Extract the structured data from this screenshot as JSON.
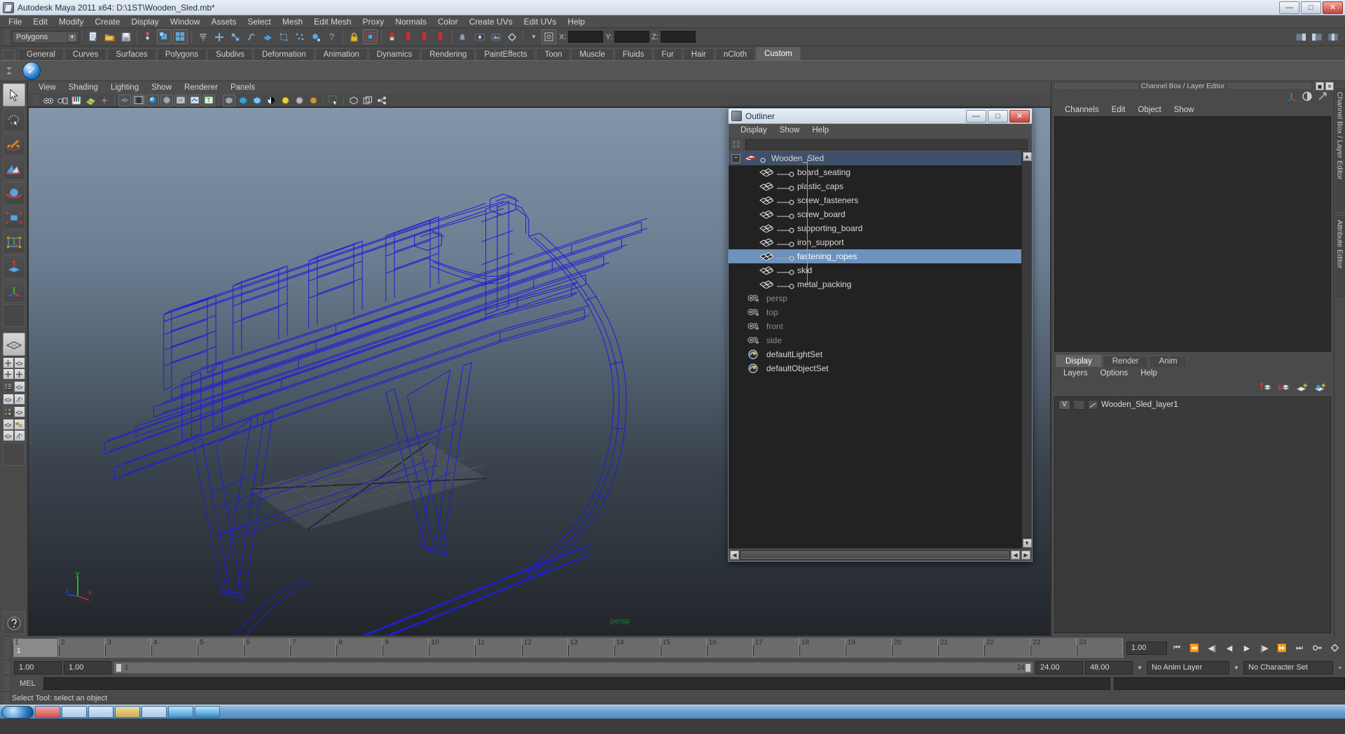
{
  "window": {
    "title": "Autodesk Maya 2011 x64: D:\\1ST\\Wooden_Sled.mb*",
    "icon": "maya-app-icon",
    "buttons": {
      "minimize": "—",
      "maximize": "□",
      "close": "✕"
    }
  },
  "menubar": {
    "items": [
      "File",
      "Edit",
      "Modify",
      "Create",
      "Display",
      "Window",
      "Assets",
      "Select",
      "Mesh",
      "Edit Mesh",
      "Proxy",
      "Normals",
      "Color",
      "Create UVs",
      "Edit UVs",
      "Help"
    ]
  },
  "statusline": {
    "selection_mode": "Polygons",
    "coord_labels": {
      "x": "X:",
      "y": "Y:",
      "z": "Z:"
    },
    "coord_values": {
      "x": "",
      "y": "",
      "z": ""
    }
  },
  "shelf": {
    "tabs": [
      "General",
      "Curves",
      "Surfaces",
      "Polygons",
      "Subdivs",
      "Deformation",
      "Animation",
      "Dynamics",
      "Rendering",
      "PaintEffects",
      "Toon",
      "Muscle",
      "Fluids",
      "Fur",
      "Hair",
      "nCloth",
      "Custom"
    ],
    "active_tab": "Custom"
  },
  "viewport": {
    "menus": [
      "View",
      "Shading",
      "Lighting",
      "Show",
      "Renderer",
      "Panels"
    ],
    "camera_label": "persp",
    "axis_labels": {
      "x": "x",
      "y": "y",
      "z": "z"
    },
    "wireframe_color": "#1a1ad4"
  },
  "outliner": {
    "title": "Outliner",
    "icon": "maya-app-icon",
    "buttons": {
      "minimize": "—",
      "maximize": "□",
      "close": "✕"
    },
    "menus": [
      "Display",
      "Show",
      "Help"
    ],
    "search_value": "",
    "search_placeholder": "",
    "selected_node": "fastening_ropes",
    "nodes": [
      {
        "label": "Wooden_Sled",
        "type": "group",
        "depth": 0,
        "selected": false,
        "dim": false,
        "expanded": true
      },
      {
        "label": "board_seating",
        "type": "mesh",
        "depth": 1,
        "selected": false,
        "dim": false
      },
      {
        "label": "plastic_caps",
        "type": "mesh",
        "depth": 1,
        "selected": false,
        "dim": false
      },
      {
        "label": "screw_fasteners",
        "type": "mesh",
        "depth": 1,
        "selected": false,
        "dim": false
      },
      {
        "label": "screw_board",
        "type": "mesh",
        "depth": 1,
        "selected": false,
        "dim": false
      },
      {
        "label": "supporting_board",
        "type": "mesh",
        "depth": 1,
        "selected": false,
        "dim": false
      },
      {
        "label": "iron_support",
        "type": "mesh",
        "depth": 1,
        "selected": false,
        "dim": false
      },
      {
        "label": "fastening_ropes",
        "type": "mesh",
        "depth": 1,
        "selected": true,
        "dim": false
      },
      {
        "label": "skid",
        "type": "mesh",
        "depth": 1,
        "selected": false,
        "dim": false
      },
      {
        "label": "metal_packing",
        "type": "mesh",
        "depth": 1,
        "selected": false,
        "dim": false,
        "last": true
      },
      {
        "label": "persp",
        "type": "camera",
        "depth": 0,
        "selected": false,
        "dim": true
      },
      {
        "label": "top",
        "type": "camera",
        "depth": 0,
        "selected": false,
        "dim": true
      },
      {
        "label": "front",
        "type": "camera",
        "depth": 0,
        "selected": false,
        "dim": true
      },
      {
        "label": "side",
        "type": "camera",
        "depth": 0,
        "selected": false,
        "dim": true
      },
      {
        "label": "defaultLightSet",
        "type": "set",
        "depth": 0,
        "selected": false,
        "dim": false
      },
      {
        "label": "defaultObjectSet",
        "type": "set",
        "depth": 0,
        "selected": false,
        "dim": false
      }
    ]
  },
  "channelbox": {
    "panel_title": "Channel Box / Layer Editor",
    "menus": [
      "Channels",
      "Edit",
      "Object",
      "Show"
    ],
    "sidebar_tabs": [
      "Channel Box / Layer Editor",
      "Attribute Editor"
    ]
  },
  "layereditor": {
    "tabs": [
      "Display",
      "Render",
      "Anim"
    ],
    "active_tab": "Display",
    "menus": [
      "Layers",
      "Options",
      "Help"
    ],
    "layers": [
      {
        "visibility": "V",
        "name": "Wooden_Sled_layer1"
      }
    ]
  },
  "timeslider": {
    "frames": [
      "1",
      "2",
      "3",
      "4",
      "5",
      "6",
      "7",
      "8",
      "9",
      "10",
      "11",
      "12",
      "13",
      "14",
      "15",
      "16",
      "17",
      "18",
      "19",
      "20",
      "21",
      "22",
      "23",
      "24"
    ],
    "current_frame": "1",
    "current_frame_field": "1.00",
    "playback_buttons": [
      "⏮",
      "⏪",
      "◀|",
      "◀",
      "▶",
      "|▶",
      "⏩",
      "⏭"
    ]
  },
  "rangeslider": {
    "start_field": "1.00",
    "end_field": "1.00",
    "range_start": "1",
    "range_end": "24",
    "playback_start": "24.00",
    "playback_end": "48.00",
    "anim_layer": "No Anim Layer",
    "character_set": "No Character Set"
  },
  "commandline": {
    "label": "MEL",
    "input_value": "",
    "status_text": "Select Tool: select an object"
  }
}
